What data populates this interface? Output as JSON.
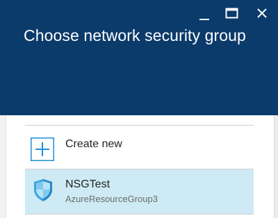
{
  "header": {
    "title": "Choose network security group"
  },
  "window_controls": {
    "minimize_icon": "minimize-icon",
    "maximize_icon": "maximize-icon",
    "close_icon": "close-icon"
  },
  "list": {
    "create_label": "Create new",
    "items": [
      {
        "name": "NSGTest",
        "resource_group": "AzureResourceGroup3",
        "selected": true
      }
    ]
  },
  "colors": {
    "header_bg": "#0b3b6b",
    "selected_bg": "#cdeaf5",
    "accent": "#1e8fd6"
  }
}
